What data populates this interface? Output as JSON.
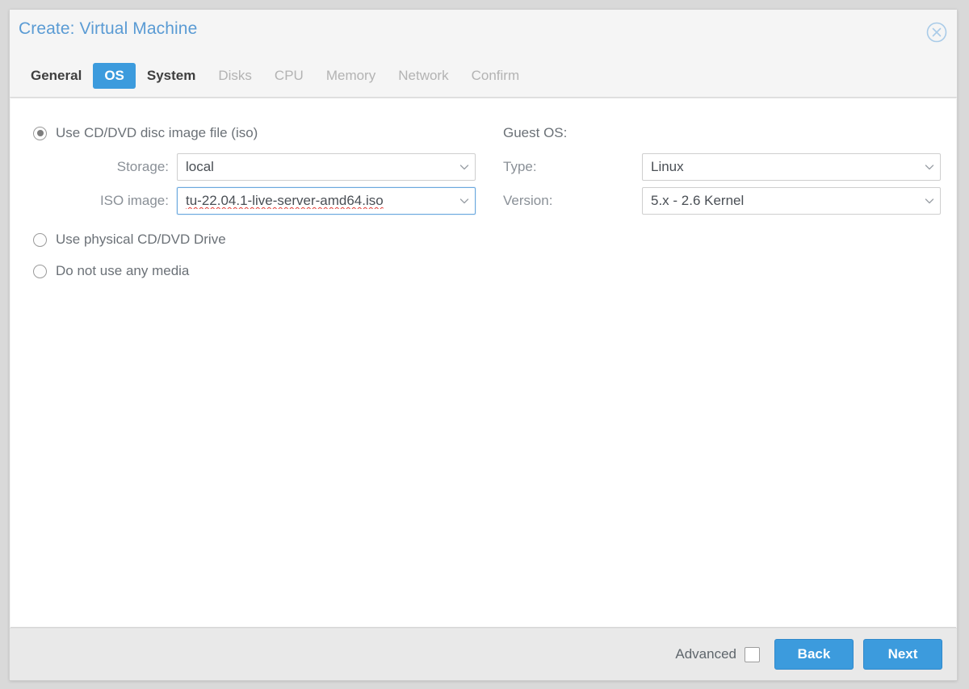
{
  "dialog": {
    "title": "Create: Virtual Machine",
    "close_icon": "close-circle-icon"
  },
  "tabs": [
    {
      "label": "General",
      "state": "enabled"
    },
    {
      "label": "OS",
      "state": "active"
    },
    {
      "label": "System",
      "state": "enabled"
    },
    {
      "label": "Disks",
      "state": "disabled"
    },
    {
      "label": "CPU",
      "state": "disabled"
    },
    {
      "label": "Memory",
      "state": "disabled"
    },
    {
      "label": "Network",
      "state": "disabled"
    },
    {
      "label": "Confirm",
      "state": "disabled"
    }
  ],
  "media": {
    "options": [
      {
        "label": "Use CD/DVD disc image file (iso)",
        "selected": true
      },
      {
        "label": "Use physical CD/DVD Drive",
        "selected": false
      },
      {
        "label": "Do not use any media",
        "selected": false
      }
    ],
    "storage_label": "Storage:",
    "storage_value": "local",
    "iso_label": "ISO image:",
    "iso_value": "tu-22.04.1-live-server-amd64.iso"
  },
  "guest_os": {
    "heading": "Guest OS:",
    "type_label": "Type:",
    "type_value": "Linux",
    "version_label": "Version:",
    "version_value": "5.x - 2.6 Kernel"
  },
  "footer": {
    "advanced_label": "Advanced",
    "advanced_checked": false,
    "back_label": "Back",
    "next_label": "Next"
  },
  "colors": {
    "accent": "#3c9bdd",
    "title": "#5a9bd4",
    "focus_border": "#6aa8de",
    "spellcheck": "#e23b34",
    "footer_bg": "#e9e9e9"
  }
}
